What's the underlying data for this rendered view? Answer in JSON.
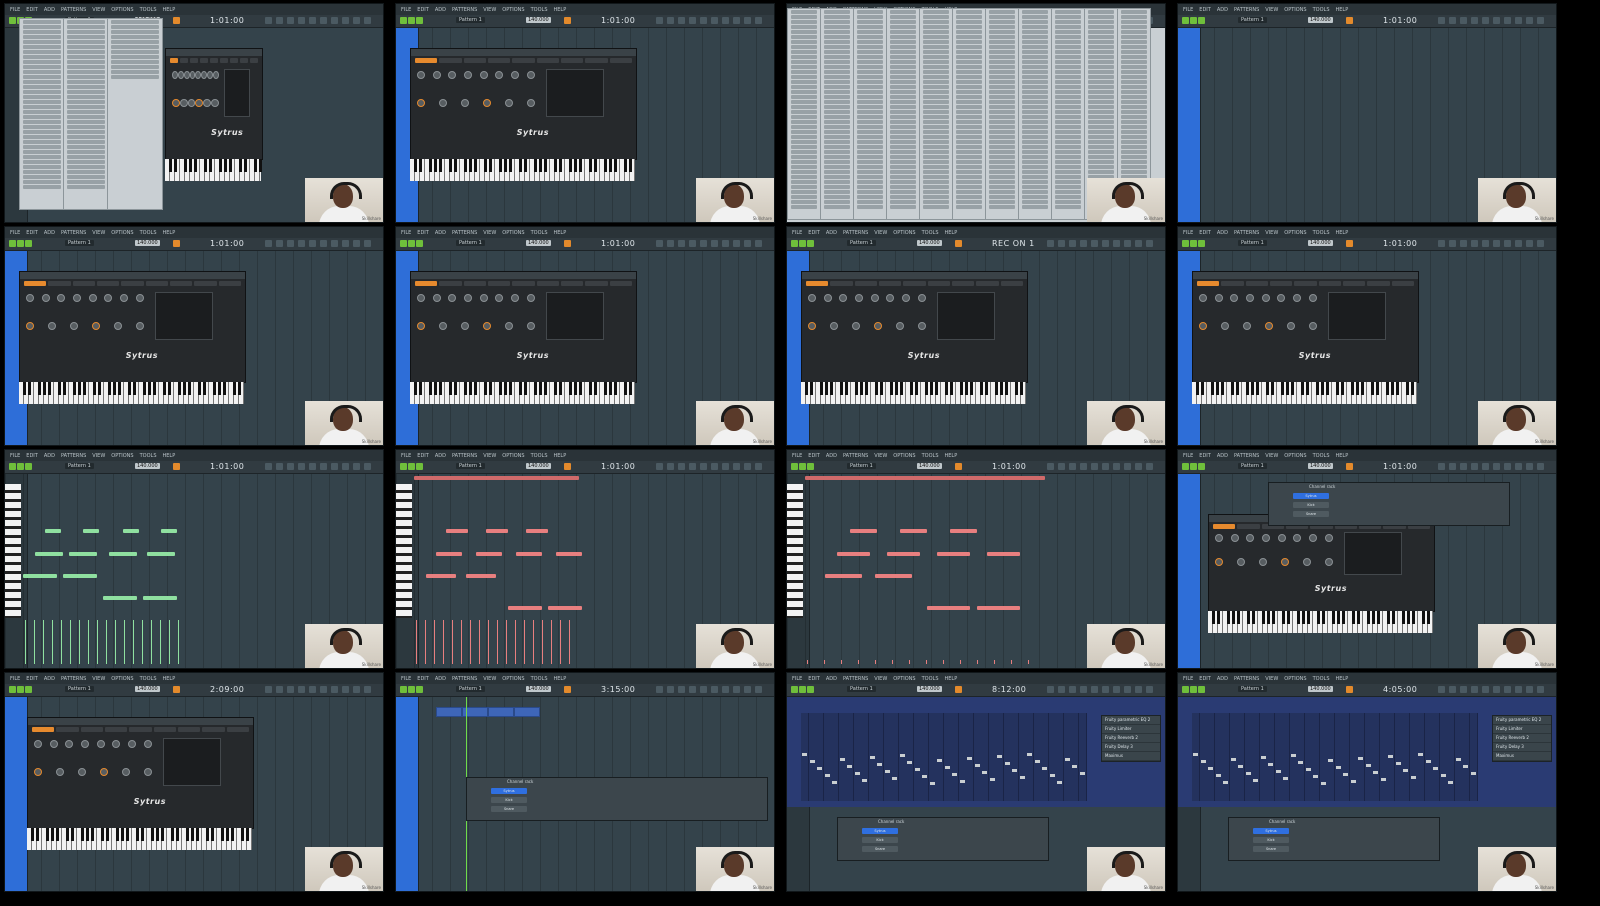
{
  "menubar": [
    "FILE",
    "EDIT",
    "ADD",
    "PATTERNS",
    "VIEW",
    "OPTIONS",
    "TOOLS",
    "HELP"
  ],
  "watermark": "Skillshare",
  "tiles": [
    {
      "clock": "1:01:00",
      "tempo": "140.000",
      "pattern": "Pattern 1",
      "view": "menu"
    },
    {
      "clock": "1:01:00",
      "tempo": "140.000",
      "pattern": "Pattern 1",
      "view": "plugin"
    },
    {
      "clock": "1:01:00",
      "tempo": "140.000",
      "pattern": "Pattern 1",
      "view": "browser"
    },
    {
      "clock": "1:01:00",
      "tempo": "140.000",
      "pattern": "Pattern 1",
      "view": "playlist"
    },
    {
      "clock": "1:01:00",
      "tempo": "140.000",
      "pattern": "Pattern 1",
      "view": "plugin"
    },
    {
      "clock": "1:01:00",
      "tempo": "140.000",
      "pattern": "Pattern 1",
      "view": "plugin"
    },
    {
      "clock": "REC ON 1",
      "tempo": "140.000",
      "pattern": "Pattern 1",
      "view": "plugin"
    },
    {
      "clock": "1:01:00",
      "tempo": "140.000",
      "pattern": "Pattern 1",
      "view": "plugin"
    },
    {
      "clock": "1:01:00",
      "tempo": "140.000",
      "pattern": "Pattern 1",
      "view": "pianoroll-green"
    },
    {
      "clock": "1:01:00",
      "tempo": "140.000",
      "pattern": "Pattern 1",
      "view": "pianoroll-red"
    },
    {
      "clock": "1:01:00",
      "tempo": "140.000",
      "pattern": "Pattern 1",
      "view": "pianoroll-red"
    },
    {
      "clock": "1:01:00",
      "tempo": "140.000",
      "pattern": "Pattern 1",
      "view": "channelrack"
    },
    {
      "clock": "2:09:00",
      "tempo": "140.000",
      "pattern": "Pattern 1",
      "view": "plugin"
    },
    {
      "clock": "3:15:00",
      "tempo": "140.000",
      "pattern": "Pattern 1",
      "view": "channelrack-playlist"
    },
    {
      "clock": "8:12:00",
      "tempo": "140.000",
      "pattern": "Pattern 1",
      "view": "mixer"
    },
    {
      "clock": "4:05:00",
      "tempo": "140.000",
      "pattern": "Pattern 1",
      "view": "mixer"
    }
  ],
  "plugin": {
    "logo": "Sytrus"
  },
  "channel_rack": {
    "title": "Channel rack",
    "channels": [
      "Sytrus",
      "Kick",
      "Snare"
    ]
  },
  "mixer_fx": [
    "Fruity parametric EQ 2",
    "Fruity Limiter",
    "Fruity Reeverb 2",
    "Fruity Delay 3",
    "Maximus"
  ],
  "colors": {
    "accent": "#e68a2e",
    "note_green": "#8fe0a0",
    "note_red": "#e87f7f",
    "playlist_blue": "#2e6ed8"
  }
}
